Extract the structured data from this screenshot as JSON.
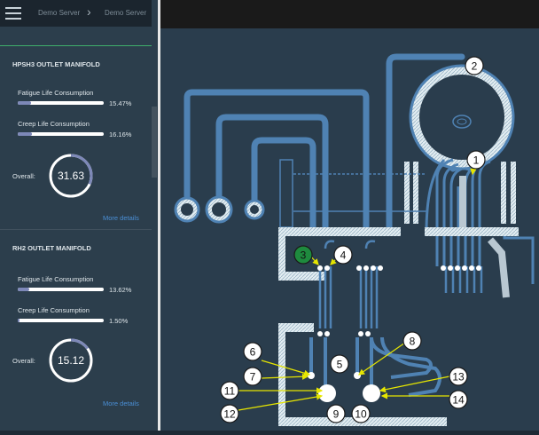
{
  "header": {
    "breadcrumb": [
      "Demo Server",
      "Demo Server"
    ],
    "breadcrumb_separator": "›"
  },
  "panels": [
    {
      "title": "HPSH3 OUTLET MANIFOLD",
      "metrics": [
        {
          "label": "Fatigue Life Consumption",
          "value_text": "15.47%",
          "fraction": 0.1547
        },
        {
          "label": "Creep Life Consumption",
          "value_text": "16.16%",
          "fraction": 0.1616
        }
      ],
      "overall_label": "Overall:",
      "overall_value": "31.63",
      "overall_fraction": 0.3163,
      "more_link": "More details"
    },
    {
      "title": "RH2 OUTLET MANIFOLD",
      "metrics": [
        {
          "label": "Fatigue Life Consumption",
          "value_text": "13.62%",
          "fraction": 0.1362
        },
        {
          "label": "Creep Life Consumption",
          "value_text": "1.50%",
          "fraction": 0.015
        }
      ],
      "overall_label": "Overall:",
      "overall_value": "15.12",
      "overall_fraction": 0.1512,
      "more_link": "More details"
    }
  ],
  "diagram": {
    "markers": [
      {
        "label": "1",
        "active": false
      },
      {
        "label": "2",
        "active": false
      },
      {
        "label": "3",
        "active": true
      },
      {
        "label": "4",
        "active": false
      },
      {
        "label": "5",
        "active": false
      },
      {
        "label": "6",
        "active": false
      },
      {
        "label": "7",
        "active": false
      },
      {
        "label": "8",
        "active": false
      },
      {
        "label": "9",
        "active": false
      },
      {
        "label": "10",
        "active": false
      },
      {
        "label": "11",
        "active": false
      },
      {
        "label": "12",
        "active": false
      },
      {
        "label": "13",
        "active": false
      },
      {
        "label": "14",
        "active": false
      }
    ],
    "colors": {
      "pipe": "#4f82b3",
      "marker_fill": "#ffffff",
      "marker_active": "#1e8a3e",
      "arrow": "#e6e600",
      "hatch": "#cfe0ea"
    }
  }
}
